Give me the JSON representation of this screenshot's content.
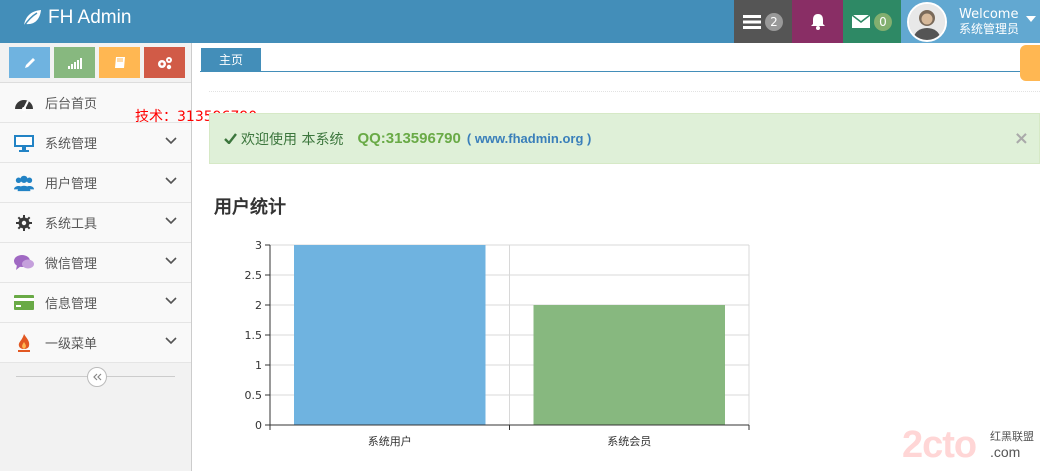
{
  "navbar": {
    "brand": "FH Admin",
    "tasks_count": "2",
    "messages_count": "0",
    "user_welcome": "Welcome",
    "user_name": "系统管理员"
  },
  "sidebar": {
    "items": [
      {
        "label": "后台首页",
        "icon": "dashboard-icon"
      },
      {
        "label": "系统管理",
        "icon": "desktop-icon"
      },
      {
        "label": "用户管理",
        "icon": "users-icon"
      },
      {
        "label": "系统工具",
        "icon": "cog-icon"
      },
      {
        "label": "微信管理",
        "icon": "comments-icon"
      },
      {
        "label": "信息管理",
        "icon": "credit-card-icon"
      },
      {
        "label": "一级菜单",
        "icon": "fire-icon"
      }
    ]
  },
  "watermark_tech": "技术：313596790",
  "tabs": [
    "主页"
  ],
  "alert": {
    "welcome": "欢迎使用 本系统",
    "qq": "QQ:313596790",
    "site": "( www.fhadmin.org )"
  },
  "section_title": "用户统计",
  "chart_data": {
    "type": "bar",
    "categories": [
      "系统用户",
      "系统会员"
    ],
    "values": [
      3,
      2
    ],
    "colors": [
      "#6fb3e0",
      "#87b87f"
    ],
    "ylim": [
      0,
      3
    ],
    "yticks": [
      0,
      0.5,
      1,
      1.5,
      2,
      2.5,
      3
    ],
    "title": "",
    "xlabel": "",
    "ylabel": "",
    "grid": true
  },
  "logo_watermark": {
    "big": "2cto",
    "line1": "红黑联盟",
    "line2": ".com"
  }
}
